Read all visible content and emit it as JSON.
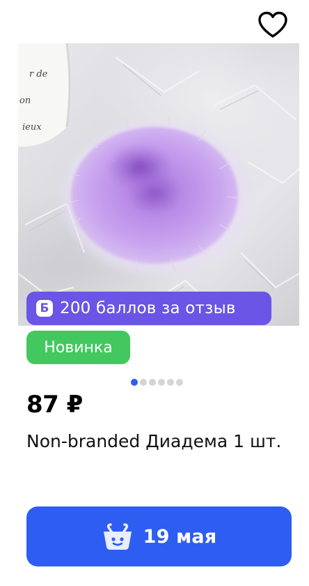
{
  "product": {
    "price": "87 ₽",
    "title": "Non-branded Диадема 1 шт.",
    "reward_badge": {
      "icon_letter": "Б",
      "label": "200 баллов за отзыв"
    },
    "new_badge": "Новинка",
    "image_alt": "Фото товара",
    "gallery_dots_total": 6,
    "gallery_dots_active": 1,
    "photo_cup_text": [
      "r de",
      "on",
      "ieux"
    ]
  },
  "actions": {
    "favorite_icon": "heart-outline-icon",
    "cart_icon": "basket-icon",
    "cart_button_label": "19 мая"
  },
  "colors": {
    "reward_badge": "#6a55e6",
    "new_badge": "#43c860",
    "cart_button": "#2e5df1",
    "active_dot": "#2f5bf0",
    "inactive_dot": "#d5d5d9"
  }
}
